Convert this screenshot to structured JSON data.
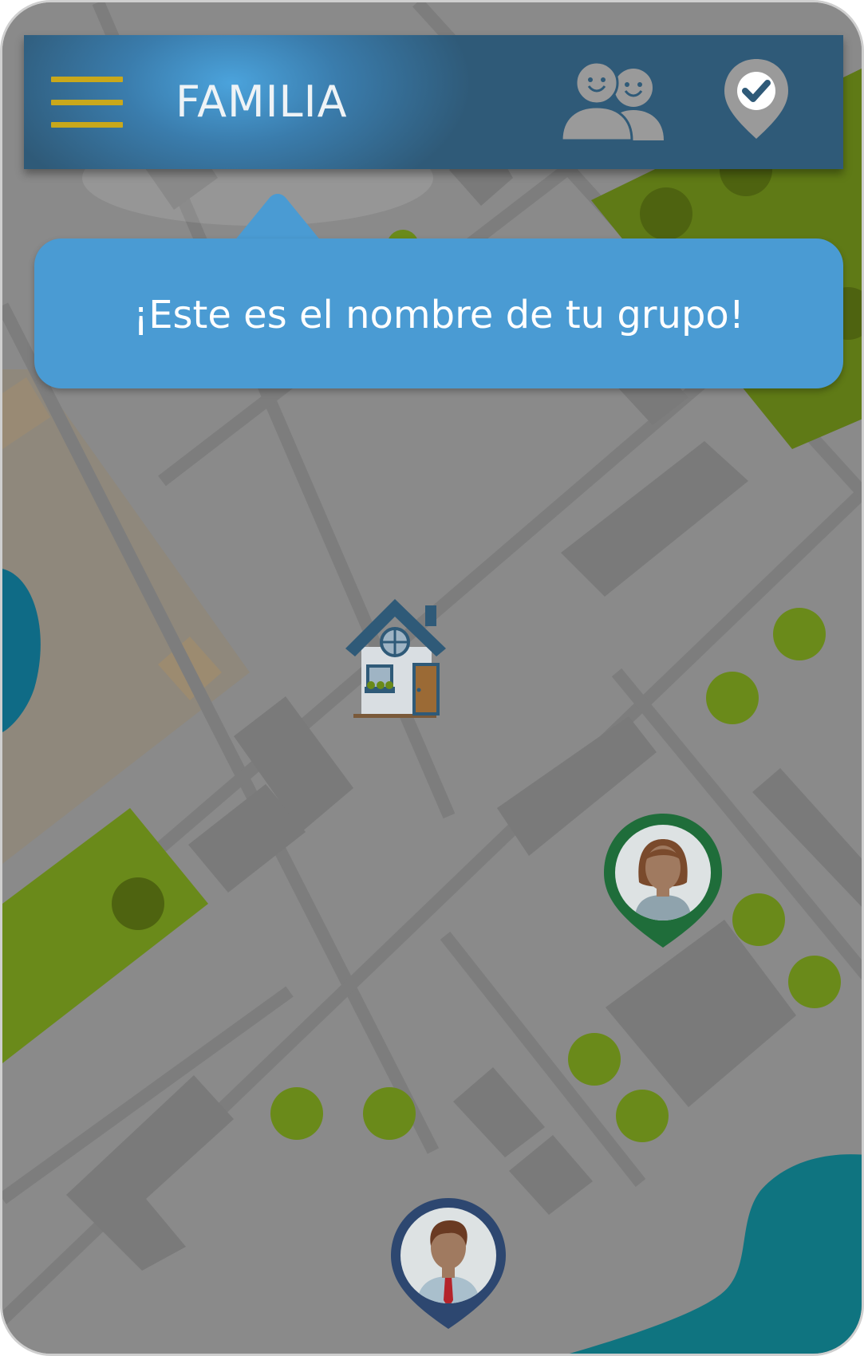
{
  "header": {
    "title": "FAMILIA",
    "menu_icon": "hamburger-menu-icon",
    "group_icon": "group-members-icon",
    "location_icon": "location-check-icon",
    "colors": {
      "bar_start": "#4ba3dc",
      "bar_end": "#2f5a78",
      "menu": "#c9a81b",
      "icons": "#9a9a9a"
    }
  },
  "tooltip": {
    "text": "¡Este es el nombre de tu grupo!",
    "color": "#4a9bd3"
  },
  "map": {
    "background": "#8a8a8a",
    "road_color": "#7d7d7d",
    "park_color": "#6a8a1a",
    "water_color": "#0f7480",
    "home_marker": "home-icon",
    "members": [
      {
        "icon": "woman-avatar-icon",
        "ring_color": "#1f6d3a"
      },
      {
        "icon": "man-avatar-icon",
        "ring_color": "#2d4770"
      }
    ]
  }
}
